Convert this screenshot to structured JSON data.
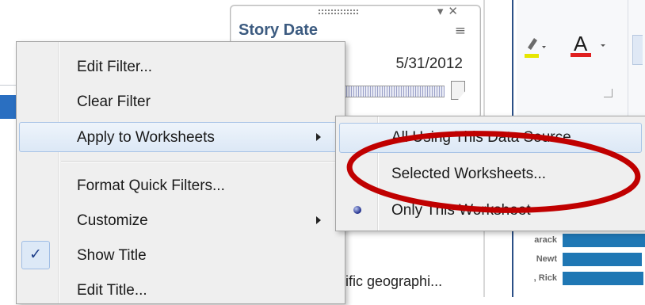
{
  "filter_card": {
    "title": "Story Date",
    "date_value": "5/31/2012",
    "menu_glyph": "≡",
    "window_controls": "▾✕"
  },
  "background": {
    "snippet_text": "ific geographi...",
    "bar_chart_labels": [
      "arack",
      "Newt",
      ", Rick"
    ],
    "bar_values": [
      100,
      96,
      98
    ],
    "colors": {
      "bar": "#1f77b4",
      "font_color_underline": "#e02020",
      "highlight_underline": "#e6e600"
    }
  },
  "context_menu": {
    "items": [
      {
        "label": "Edit Filter...",
        "has_submenu": false,
        "checked": false
      },
      {
        "label": "Clear Filter",
        "has_submenu": false,
        "checked": false
      },
      {
        "label": "Apply to Worksheets",
        "has_submenu": true,
        "checked": false,
        "highlighted": true
      },
      {
        "label": "Format Quick Filters...",
        "has_submenu": false,
        "checked": false
      },
      {
        "label": "Customize",
        "has_submenu": true,
        "checked": false
      },
      {
        "label": "Show Title",
        "has_submenu": false,
        "checked": true
      },
      {
        "label": "Edit Title...",
        "has_submenu": false,
        "checked": false
      }
    ],
    "check_glyph": "✓"
  },
  "submenu": {
    "items": [
      {
        "label": "All Using This Data Source",
        "selected": false,
        "highlighted": true
      },
      {
        "label": "Selected Worksheets...",
        "selected": false,
        "highlighted": false
      },
      {
        "label": "Only This Worksheet",
        "selected": true,
        "highlighted": false
      }
    ]
  },
  "annotation": {
    "shape": "ellipse",
    "color": "#c00000",
    "target": "Selected Worksheets..."
  }
}
